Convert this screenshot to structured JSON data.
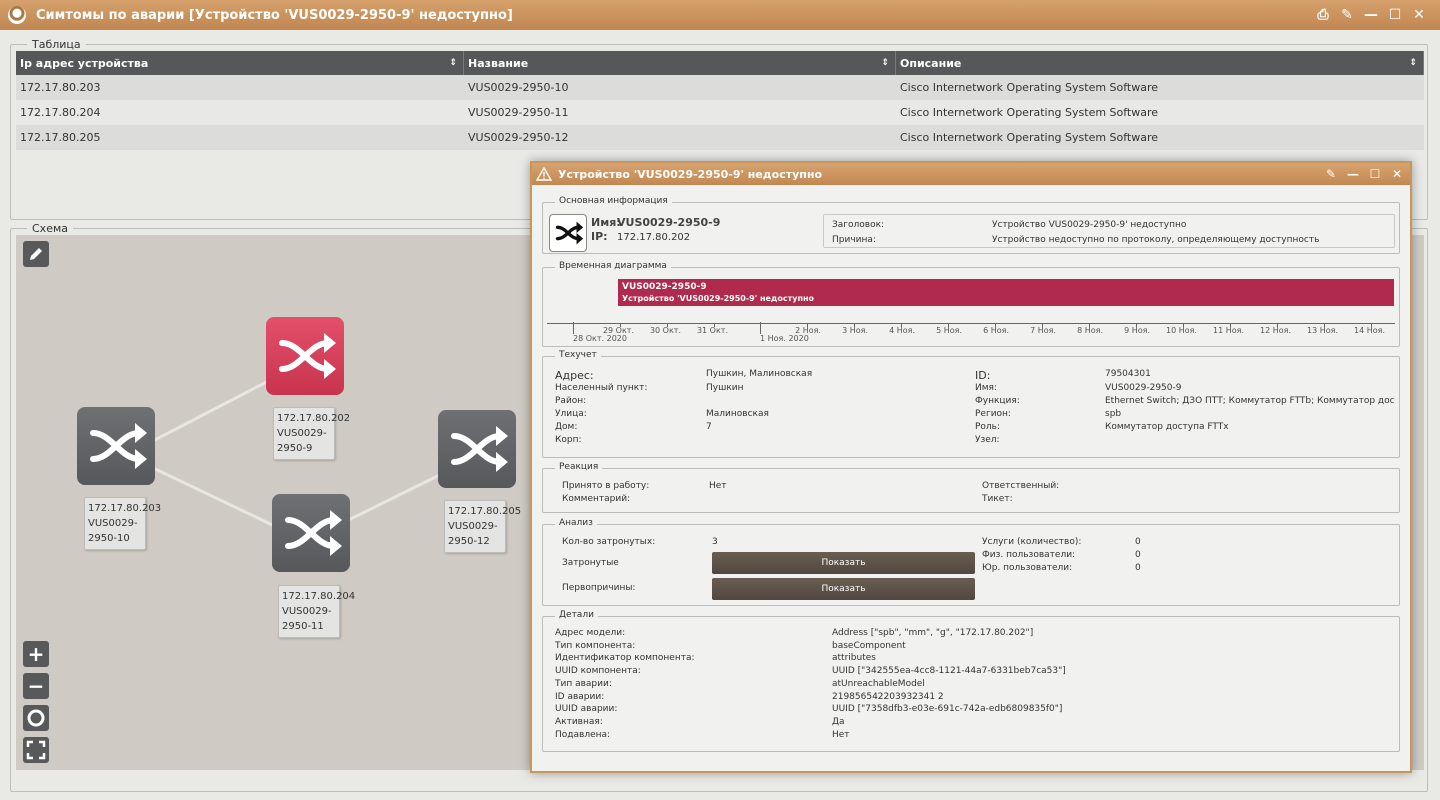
{
  "window": {
    "title": "Симтомы по аварии [Устройство 'VUS0029-2950-9' недоступно]",
    "icons": [
      "print-icon",
      "pin-icon",
      "minimize-icon",
      "maximize-icon",
      "close-icon"
    ]
  },
  "table_section": {
    "legend": "Таблица",
    "columns": [
      "Ip адрес устройства",
      "Название",
      "Описание"
    ],
    "rows": [
      [
        "172.17.80.203",
        "VUS0029-2950-10",
        "Cisco Internetwork Operating System Software"
      ],
      [
        "172.17.80.204",
        "VUS0029-2950-11",
        "Cisco Internetwork Operating System Software"
      ],
      [
        "172.17.80.205",
        "VUS0029-2950-12",
        "Cisco Internetwork Operating System Software"
      ]
    ]
  },
  "schema_section": {
    "legend": "Схема",
    "nodes": [
      {
        "ip": "172.17.80.202",
        "name_l1": "VUS0029-",
        "name_l2": "2950-9",
        "status": "down"
      },
      {
        "ip": "172.17.80.203",
        "name_l1": "VUS0029-",
        "name_l2": "2950-10",
        "status": "ok"
      },
      {
        "ip": "172.17.80.204",
        "name_l1": "VUS0029-",
        "name_l2": "2950-11",
        "status": "ok"
      },
      {
        "ip": "172.17.80.205",
        "name_l1": "VUS0029-",
        "name_l2": "2950-12",
        "status": "ok"
      }
    ],
    "zoom_controls": [
      "zoom-in-icon",
      "zoom-out-icon",
      "reset-zoom-icon",
      "fit-screen-icon"
    ]
  },
  "dialog": {
    "title": "Устройство 'VUS0029-2950-9' недоступно",
    "basic": {
      "legend": "Основная информация",
      "name_label": "Имя:",
      "name_value": "VUS0029-2950-9",
      "ip_label": "IP:",
      "ip_value": "172.17.80.202",
      "header_label": "Заголовок:",
      "header_value": "Устройство VUS0029-2950-9' недоступно",
      "reason_label": "Причина:",
      "reason_value": "Устройство недоступно по протоколу, определяющему доступность"
    },
    "timeline": {
      "legend": "Временная диаграмма",
      "bar_title": "VUS0029-2950-9",
      "bar_subtitle": "Устройство 'VUS0029-2950-9' недоступно",
      "ticks": [
        "29 Окт.",
        "30 Окт.",
        "31 Окт.",
        "2 Ноя.",
        "3 Ноя.",
        "4 Ноя.",
        "5 Ноя.",
        "6 Ноя.",
        "7 Ноя.",
        "8 Ноя.",
        "9 Ноя.",
        "10 Ноя.",
        "11 Ноя.",
        "12 Ноя.",
        "13 Ноя.",
        "14 Ноя."
      ],
      "major_ticks": [
        "28 Окт. 2020",
        "1 Ноя. 2020"
      ]
    },
    "techaccount": {
      "legend": "Техучет",
      "left": [
        {
          "label": "Адрес:",
          "value": "Пушкин, Малиновская"
        },
        {
          "label": "Населенный пункт:",
          "value": "Пушкин"
        },
        {
          "label": "Район:",
          "value": ""
        },
        {
          "label": "Улица:",
          "value": "Малиновская"
        },
        {
          "label": "Дом:",
          "value": "7"
        },
        {
          "label": "Корп:",
          "value": ""
        }
      ],
      "right": [
        {
          "label": "ID:",
          "value": "79504301"
        },
        {
          "label": "Имя:",
          "value": "VUS0029-2950-9"
        },
        {
          "label": "Функция:",
          "value": "Ethernet Switch; ДЗО ПТТ; Коммутатор FTTb; Коммутатор доступа CE;"
        },
        {
          "label": "Регион:",
          "value": "spb"
        },
        {
          "label": "Роль:",
          "value": "Коммутатор доступа FTTx"
        },
        {
          "label": "Узел:",
          "value": ""
        }
      ]
    },
    "reaction": {
      "legend": "Реакция",
      "accepted_label": "Принято в работу:",
      "accepted_value": "Нет",
      "comment_label": "Комментарий:",
      "responsible_label": "Ответственный:",
      "ticket_label": "Тикет:"
    },
    "analysis": {
      "legend": "Анализ",
      "affected_count_label": "Кол-во затронутых:",
      "affected_count_value": "3",
      "affected_label": "Затронутые",
      "root_causes_label": "Первопричины:",
      "show_button": "Показать",
      "services_label": "Услуги (количество):",
      "services_value": "0",
      "phys_users_label": "Физ. пользователи:",
      "phys_users_value": "0",
      "legal_users_label": "Юр. пользователи:",
      "legal_users_value": "0"
    },
    "details": {
      "legend": "Детали",
      "rows": [
        {
          "label": "Адрес модели:",
          "value": "Address [\"spb\", \"mm\", \"g\", \"172.17.80.202\"]"
        },
        {
          "label": "Тип компонента:",
          "value": "baseComponent"
        },
        {
          "label": "Идентификатор компонента:",
          "value": "attributes"
        },
        {
          "label": "UUID компонента:",
          "value": "UUID [\"342555ea-4cc8-1121-44a7-6331beb7ca53\"]"
        },
        {
          "label": "Тип аварии:",
          "value": "atUnreachableModel"
        },
        {
          "label": "ID аварии:",
          "value": "219856542203932341 2"
        },
        {
          "label": "UUID аварии:",
          "value": "UUID [\"7358dfb3-e03e-691c-742a-edb6809835f0\"]"
        },
        {
          "label": "Активная:",
          "value": "Да"
        },
        {
          "label": "Подавлена:",
          "value": "Нет"
        }
      ]
    }
  }
}
